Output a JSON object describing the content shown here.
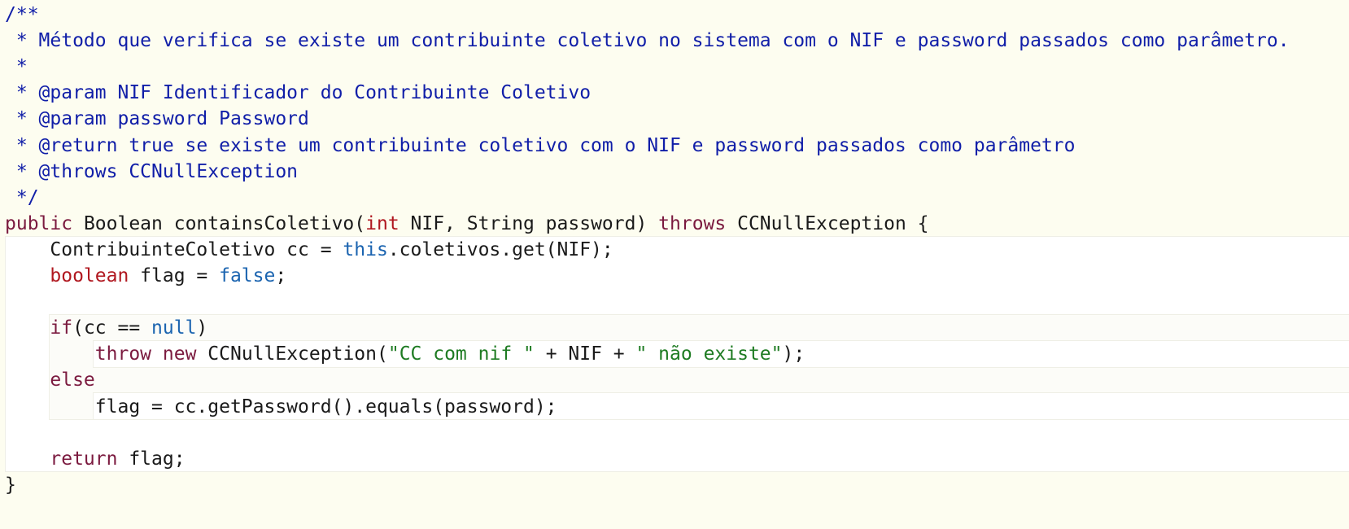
{
  "editor": {
    "lines": [
      {
        "segments": [
          {
            "t": "/**",
            "c": "cm"
          }
        ]
      },
      {
        "segments": [
          {
            "t": " * Método que verifica se existe um contribuinte coletivo no sistema com o NIF e password passados como parâmetro.",
            "c": "cm"
          }
        ]
      },
      {
        "segments": [
          {
            "t": " *",
            "c": "cm"
          }
        ]
      },
      {
        "segments": [
          {
            "t": " * @param NIF Identificador do Contribuinte Coletivo",
            "c": "cm"
          }
        ]
      },
      {
        "segments": [
          {
            "t": " * @param password Password",
            "c": "cm"
          }
        ]
      },
      {
        "segments": [
          {
            "t": " * @return true se existe um contribuinte coletivo com o NIF e password passados como parâmetro",
            "c": "cm"
          }
        ]
      },
      {
        "segments": [
          {
            "t": " * @throws CCNullException",
            "c": "cm"
          }
        ]
      },
      {
        "segments": [
          {
            "t": " */",
            "c": "cm"
          }
        ]
      },
      {
        "segments": [
          {
            "t": "public",
            "c": "kw2"
          },
          {
            "t": " Boolean containsColetivo(",
            "c": "plain"
          },
          {
            "t": "int",
            "c": "kw"
          },
          {
            "t": " NIF, String password) ",
            "c": "plain"
          },
          {
            "t": "throws",
            "c": "kw2"
          },
          {
            "t": " CCNullException {",
            "c": "plain"
          }
        ]
      },
      {
        "segments": [
          {
            "t": "    ContribuinteColetivo cc = ",
            "c": "plain"
          },
          {
            "t": "this",
            "c": "lit"
          },
          {
            "t": ".coletivos.get(NIF);",
            "c": "plain"
          }
        ]
      },
      {
        "segments": [
          {
            "t": "    ",
            "c": "plain"
          },
          {
            "t": "boolean",
            "c": "kw"
          },
          {
            "t": " flag = ",
            "c": "plain"
          },
          {
            "t": "false",
            "c": "lit"
          },
          {
            "t": ";",
            "c": "plain"
          }
        ]
      },
      {
        "segments": [
          {
            "t": "",
            "c": "plain"
          }
        ]
      },
      {
        "segments": [
          {
            "t": "    ",
            "c": "plain"
          },
          {
            "t": "if",
            "c": "kw2"
          },
          {
            "t": "(cc == ",
            "c": "plain"
          },
          {
            "t": "null",
            "c": "lit"
          },
          {
            "t": ")",
            "c": "plain"
          }
        ]
      },
      {
        "segments": [
          {
            "t": "        ",
            "c": "plain"
          },
          {
            "t": "throw",
            "c": "kw2"
          },
          {
            "t": " ",
            "c": "plain"
          },
          {
            "t": "new",
            "c": "kw2"
          },
          {
            "t": " CCNullException(",
            "c": "plain"
          },
          {
            "t": "\"CC com nif \"",
            "c": "str"
          },
          {
            "t": " + NIF + ",
            "c": "plain"
          },
          {
            "t": "\" não existe\"",
            "c": "str"
          },
          {
            "t": ");",
            "c": "plain"
          }
        ]
      },
      {
        "segments": [
          {
            "t": "    ",
            "c": "plain"
          },
          {
            "t": "else",
            "c": "kw2"
          }
        ]
      },
      {
        "segments": [
          {
            "t": "        flag = cc.getPassword().equals(password);",
            "c": "plain"
          }
        ]
      },
      {
        "segments": [
          {
            "t": "",
            "c": "plain"
          }
        ]
      },
      {
        "segments": [
          {
            "t": "    ",
            "c": "plain"
          },
          {
            "t": "return",
            "c": "kw2"
          },
          {
            "t": " flag;",
            "c": "plain"
          }
        ]
      },
      {
        "segments": [
          {
            "t": "}",
            "c": "plain"
          }
        ]
      }
    ]
  }
}
